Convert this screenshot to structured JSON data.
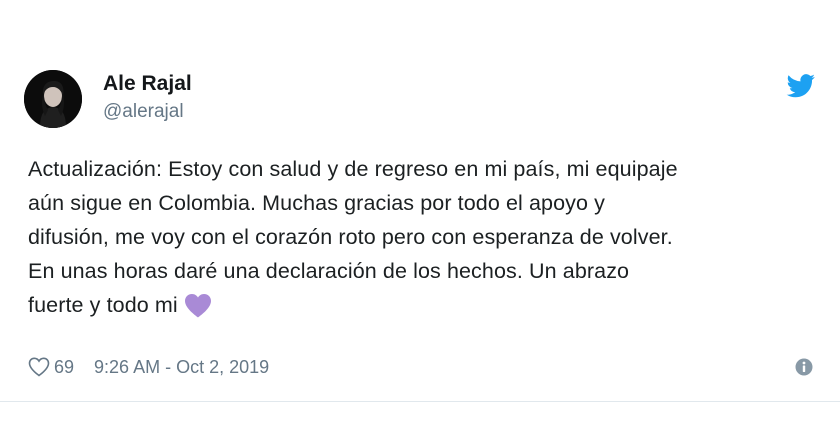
{
  "author": {
    "name": "Ale Rajal",
    "handle": "@alerajal"
  },
  "tweet": {
    "lines": [
      "Actualización: Estoy con salud y de regreso en mi país, mi equipaje",
      "aún sigue en Colombia. Muchas gracias por todo el apoyo y",
      "difusión, me voy con el corazón roto pero con esperanza de volver.",
      "En unas horas daré una declaración de los hechos. Un abrazo",
      "fuerte y todo mi"
    ],
    "emoji": "purple-heart"
  },
  "meta": {
    "likes": "69",
    "timestamp": "9:26 AM - Oct 2, 2019"
  },
  "icons": {
    "brand": "twitter-bird-icon",
    "like": "heart-outline-icon",
    "info": "info-icon"
  },
  "colors": {
    "twitter_blue": "#1da1f2",
    "secondary_text": "#657786",
    "emoji_purple": "#a98ad6",
    "divider": "#e1e8ed"
  }
}
